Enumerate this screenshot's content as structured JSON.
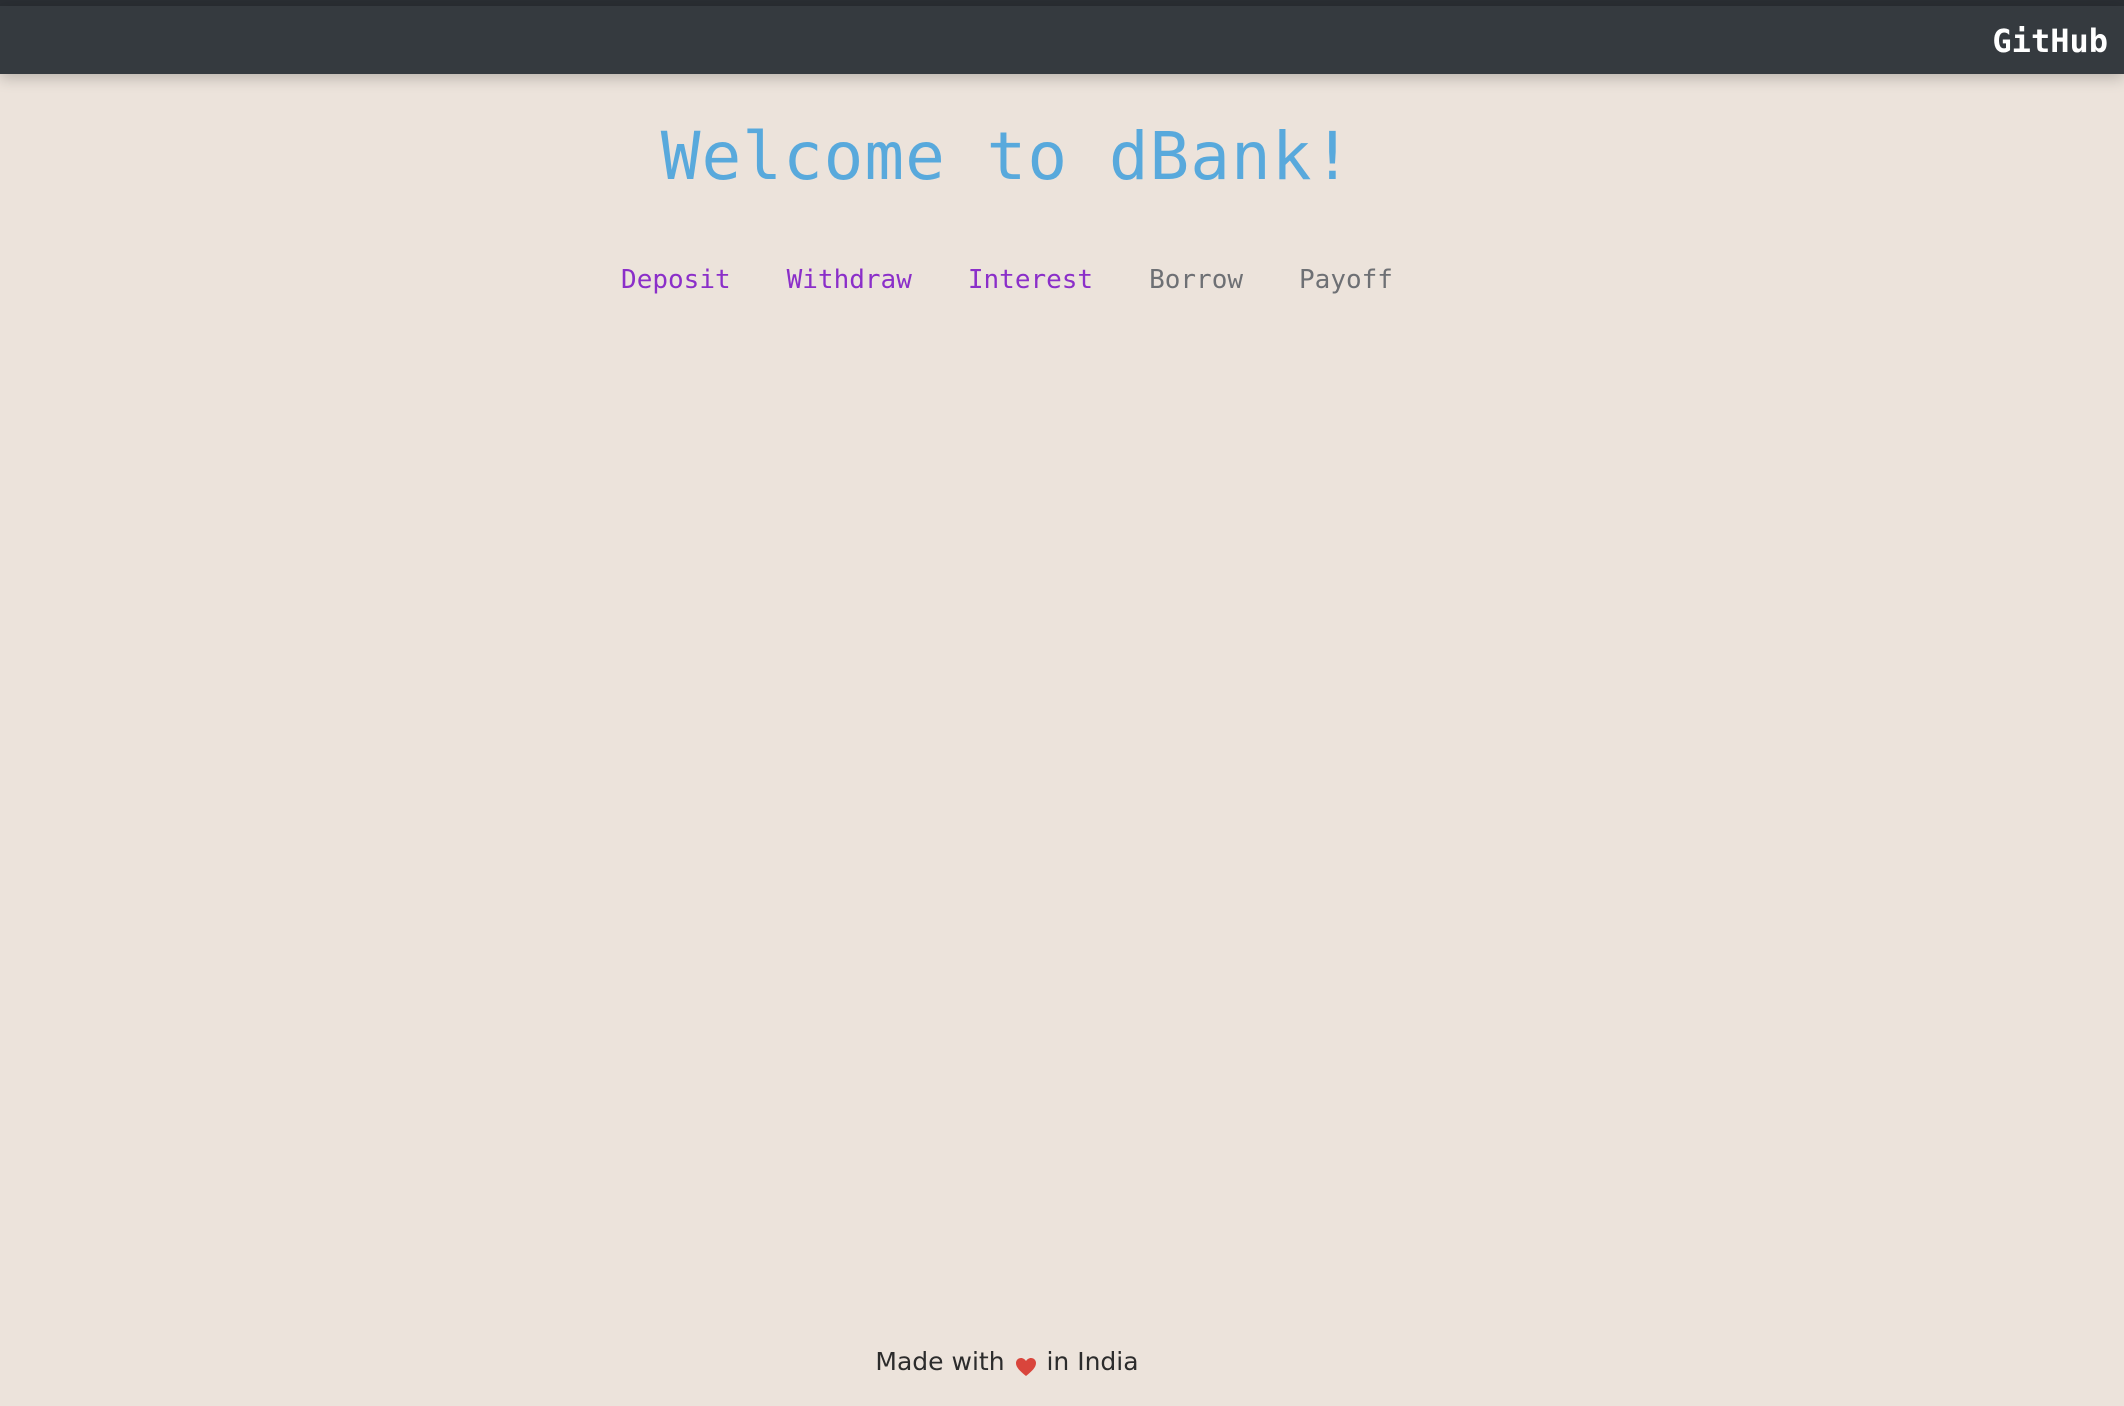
{
  "navbar": {
    "brand_label": "GitHub"
  },
  "main": {
    "title": "Welcome to dBank!",
    "tabs": [
      {
        "label": "Deposit",
        "state": "active"
      },
      {
        "label": "Withdraw",
        "state": "active"
      },
      {
        "label": "Interest",
        "state": "active"
      },
      {
        "label": "Borrow",
        "state": "disabled"
      },
      {
        "label": "Payoff",
        "state": "disabled"
      }
    ]
  },
  "footer": {
    "text_before": "Made with",
    "icon": "heart-icon",
    "text_after": "in India"
  },
  "colors": {
    "background": "#ece3db",
    "navbar": "#353a3f",
    "title": "#58a9dc",
    "tab_active": "#8b2fc9",
    "tab_disabled": "#6e7074",
    "heart": "#d9453c"
  }
}
